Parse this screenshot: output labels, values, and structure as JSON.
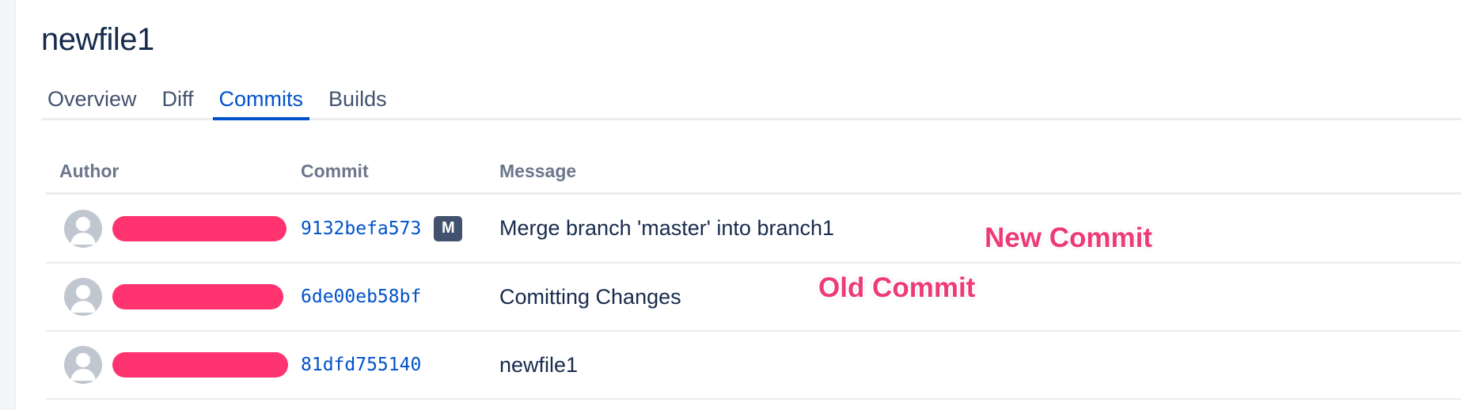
{
  "page": {
    "title": "newfile1"
  },
  "tabs": [
    {
      "label": "Overview",
      "active": false
    },
    {
      "label": "Diff",
      "active": false
    },
    {
      "label": "Commits",
      "active": true
    },
    {
      "label": "Builds",
      "active": false
    }
  ],
  "table": {
    "headers": {
      "author": "Author",
      "commit": "Commit",
      "message": "Message"
    },
    "rows": [
      {
        "avatar_icon": "default-avatar-icon",
        "author_redacted": true,
        "hash": "9132befa573",
        "merge_badge": "M",
        "message": "Merge branch 'master' into branch1"
      },
      {
        "avatar_icon": "default-avatar-icon",
        "author_redacted": true,
        "hash": "6de00eb58bf",
        "merge_badge": null,
        "message": "Comitting Changes"
      },
      {
        "avatar_icon": "default-avatar-icon",
        "author_redacted": true,
        "hash": "81dfd755140",
        "merge_badge": null,
        "message": "newfile1"
      }
    ]
  },
  "annotations": {
    "new_commit": "New Commit",
    "old_commit": "Old Commit"
  },
  "colors": {
    "accent": "#0052cc",
    "redaction": "#ff3370",
    "annotation": "#ee3a78",
    "badge_bg": "#42526e"
  }
}
